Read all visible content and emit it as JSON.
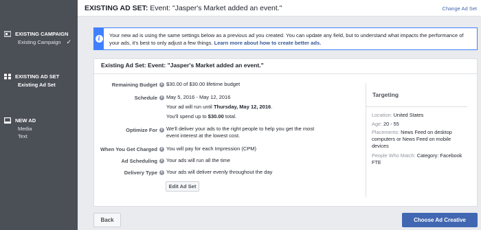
{
  "sidebar": {
    "sections": [
      {
        "title": "EXISTING CAMPAIGN",
        "items": [
          {
            "label": "Existing Campaign",
            "check": "✓"
          }
        ]
      },
      {
        "title": "EXISTING AD SET",
        "items": [
          {
            "label": "Existing Ad Set"
          }
        ]
      },
      {
        "title": "NEW AD",
        "items": [
          {
            "label": "Media"
          },
          {
            "label": "Text"
          }
        ]
      }
    ]
  },
  "header": {
    "title_bold": "EXISTING AD SET:",
    "title_rest": " Event: \"Jasper's Market added an event.\"",
    "change_link": "Change Ad Set"
  },
  "notice": {
    "icon": "info-icon",
    "text": "Your new ad is using the same settings below as a previous ad you created. You can update any field, but to understand what impacts the performance of your ads, it's best to only adjust a few things. ",
    "link": "Learn more about how to create better ads."
  },
  "panel": {
    "title": "Existing Ad Set: Event: \"Jasper's Market added an event.\"",
    "remaining_budget_label": "Remaining Budget",
    "remaining_budget_value": "$30.00 of $30.00 lifetime budget",
    "schedule_label": "Schedule",
    "schedule_dates": "May 5, 2016 - May 12, 2016",
    "schedule_run_prefix": "Your ad will run until ",
    "schedule_run_date": "Thursday, May 12, 2016",
    "schedule_run_suffix": ".",
    "schedule_spend_prefix": "You'll spend up to ",
    "schedule_spend_amount": "$30.00",
    "schedule_spend_suffix": " total.",
    "optimize_label": "Optimize For",
    "optimize_line1": "We'll deliver your ads to the right people to help you get the most",
    "optimize_line2": "event interest at the lowest cost.",
    "charged_label": "When You Get Charged",
    "charged_value": "You will pay for each Impression (CPM)",
    "scheduling_label": "Ad Scheduling",
    "scheduling_value": "Your ads will run all the time",
    "delivery_label": "Delivery Type",
    "delivery_value": "Your ads will deliver evenly throughout the day",
    "edit_button": "Edit Ad Set"
  },
  "targeting": {
    "heading": "Targeting",
    "location_key": "Location:",
    "location_val": " United States",
    "age_key": "Age:",
    "age_val": " 20 - 55",
    "placements_key": "Placements:",
    "placements_val": " News Feed on desktop computers or News Feed on mobile devices",
    "who_key": "People Who Match:",
    "who_val": " Category: Facebook FTE"
  },
  "footer": {
    "back": "Back",
    "choose": "Choose Ad Creative"
  }
}
